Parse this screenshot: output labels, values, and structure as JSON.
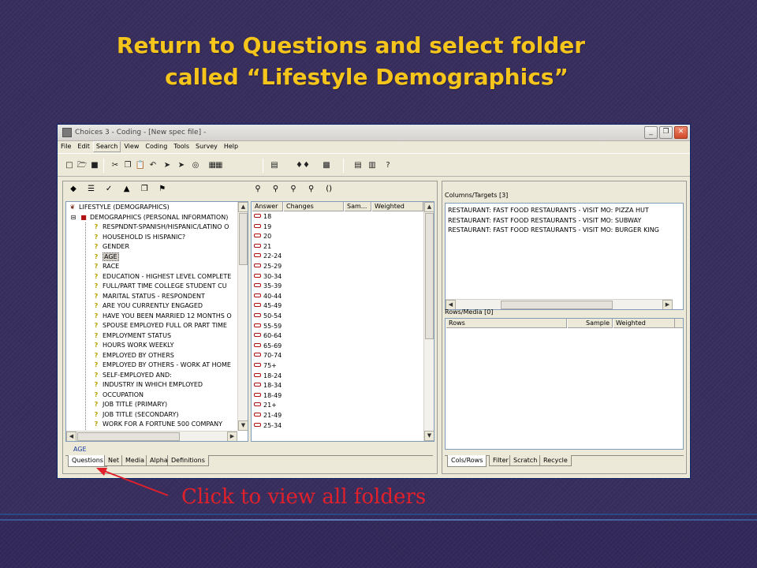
{
  "slide": {
    "title_line1": "Return to Questions and select folder",
    "title_line2": "called “Lifestyle Demographics”",
    "callout": "Click to view all folders"
  },
  "window": {
    "title": "Choices 3 - Coding - [New spec file] -",
    "controls": {
      "minimize": "_",
      "restore": "❐",
      "close": "✕"
    }
  },
  "menu": [
    "File",
    "Edit",
    "Search",
    "View",
    "Coding",
    "Tools",
    "Survey",
    "Help"
  ],
  "menu_active": "Search",
  "tree": {
    "root": "LIFESTYLE (DEMOGRAPHICS)",
    "folder": "DEMOGRAPHICS (PERSONAL INFORMATION)",
    "items": [
      "RESPNDNT-SPANISH/HISPANIC/LATINO O",
      "HOUSEHOLD IS HISPANIC?",
      "GENDER",
      "AGE",
      "RACE",
      "EDUCATION - HIGHEST LEVEL COMPLETE",
      "FULL/PART TIME COLLEGE STUDENT CU",
      "MARITAL STATUS - RESPONDENT",
      "ARE YOU CURRENTLY ENGAGED",
      "HAVE YOU BEEN MARRIED 12 MONTHS O",
      "SPOUSE EMPLOYED FULL OR PART TIME",
      "EMPLOYMENT STATUS",
      "HOURS WORK WEEKLY",
      "EMPLOYED BY OTHERS",
      "EMPLOYED BY OTHERS - WORK AT HOME",
      "SELF-EMPLOYED AND:",
      "INDUSTRY IN WHICH EMPLOYED",
      "OCCUPATION",
      "JOB TITLE (PRIMARY)",
      "JOB TITLE (SECONDARY)",
      "WORK FOR A FORTUNE 500 COMPANY"
    ],
    "selected": "AGE"
  },
  "answers": {
    "columns": [
      "Answer",
      "Changes",
      "Sam...",
      "Weighted"
    ],
    "rows": [
      "18",
      "19",
      "20",
      "21",
      "22-24",
      "25-29",
      "30-34",
      "35-39",
      "40-44",
      "45-49",
      "50-54",
      "55-59",
      "60-64",
      "65-69",
      "70-74",
      "75+",
      "18-24",
      "18-34",
      "18-49",
      "21+",
      "21-49",
      "25-34"
    ]
  },
  "current_question": "AGE",
  "left_tabs": [
    "Questions",
    "Net",
    "Media",
    "Alpha",
    "Definitions"
  ],
  "right_tabs": [
    "Cols/Rows",
    "Filter",
    "Scratch",
    "Recycle"
  ],
  "targets": {
    "label": "Columns/Targets [3]",
    "rows": [
      "RESTAURANT: FAST FOOD RESTAURANTS - VISIT MO: PIZZA HUT",
      "RESTAURANT: FAST FOOD RESTAURANTS - VISIT MO: SUBWAY",
      "RESTAURANT: FAST FOOD RESTAURANTS - VISIT MO: BURGER KING"
    ]
  },
  "rows_media": {
    "label": "Rows/Media [0]",
    "columns": [
      "Rows",
      "Sample",
      "Weighted"
    ]
  },
  "colors": {
    "slide_background": "#382e5e",
    "title": "#f5c51c",
    "callout": "#e0202a",
    "window_face": "#ece9d8"
  }
}
